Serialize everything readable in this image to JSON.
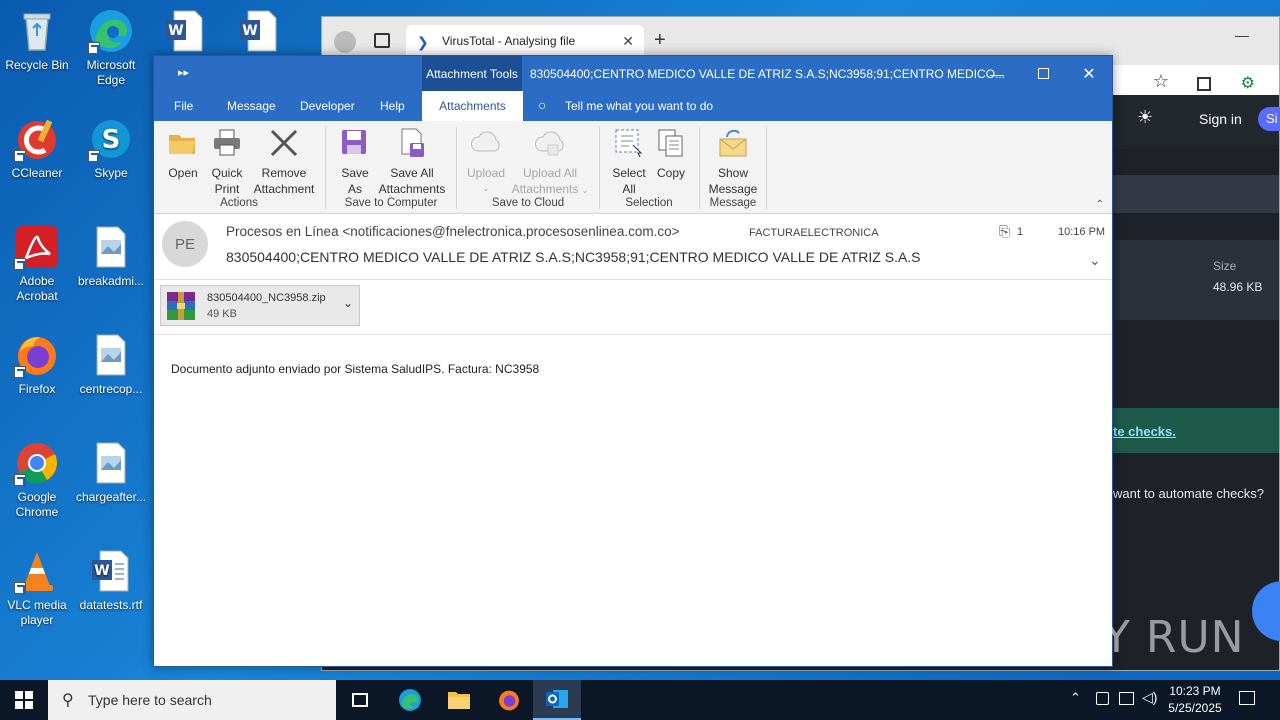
{
  "desktop": {
    "icons": [
      {
        "label": "Recycle Bin"
      },
      {
        "label": "Microsoft Edge"
      },
      {
        "label": "CCleaner"
      },
      {
        "label": "Skype"
      },
      {
        "label": "Adobe Acrobat"
      },
      {
        "label": "breakadmi..."
      },
      {
        "label": "Firefox"
      },
      {
        "label": "centrecop..."
      },
      {
        "label": "Google Chrome"
      },
      {
        "label": "chargeafter..."
      },
      {
        "label": "VLC media player"
      },
      {
        "label": "datatests.rtf"
      }
    ]
  },
  "browser": {
    "tab_title": "VirusTotal - Analysing file",
    "sign_in": "Sign in",
    "sign_up_partial": "Si",
    "size_label": "Size",
    "size_value": "48.96 KB",
    "automate_link": "te checks.",
    "automate_question": "want to automate checks?"
  },
  "outlook": {
    "context_tab": "Attachment Tools",
    "window_title": "830504400;CENTRO MEDICO VALLE DE ATRIZ S.A.S;NC3958;91;CENTRO MEDICO...",
    "tabs": [
      "File",
      "Message",
      "Developer",
      "Help",
      "Attachments"
    ],
    "tell_me": "Tell me what you want to do",
    "ribbon": {
      "open": "Open",
      "quick_print_1": "Quick",
      "quick_print_2": "Print",
      "remove_1": "Remove",
      "remove_2": "Attachment",
      "group_actions": "Actions",
      "save_as_1": "Save",
      "save_as_2": "As",
      "save_all_1": "Save All",
      "save_all_2": "Attachments",
      "group_save_computer": "Save to Computer",
      "upload": "Upload",
      "upload_all_1": "Upload All",
      "upload_all_2": "Attachments",
      "group_save_cloud": "Save to Cloud",
      "select_all_1": "Select",
      "select_all_2": "All",
      "copy": "Copy",
      "group_selection": "Selection",
      "show_message_1": "Show",
      "show_message_2": "Message",
      "group_message": "Message"
    },
    "message": {
      "avatar_initials": "PE",
      "from": "Procesos en Línea <notificaciones@fnelectronica.procesosenlinea.com.co>",
      "category": "FACTURAELECTRONICA",
      "attach_count": "1",
      "time": "10:16 PM",
      "subject": "830504400;CENTRO MEDICO VALLE DE ATRIZ S.A.S;NC3958;91;CENTRO MEDICO VALLE DE ATRIZ S.A.S",
      "attachment_name": "830504400_NC3958.zip",
      "attachment_size": "49 KB",
      "body": "Documento adjunto enviado por Sistema SaludIPS. Factura: NC3958"
    }
  },
  "taskbar": {
    "search_placeholder": "Type here to search",
    "time": "10:23 PM",
    "date": "5/25/2025"
  },
  "watermark": "ANY RUN"
}
